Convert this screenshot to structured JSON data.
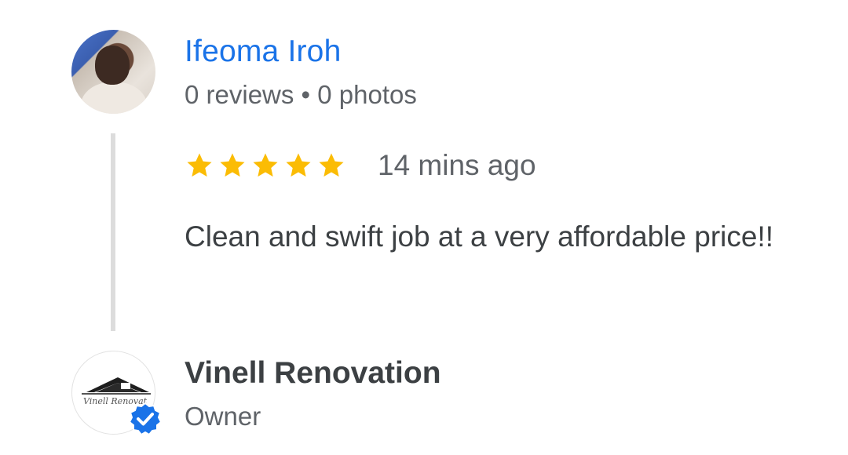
{
  "review": {
    "reviewer": {
      "name": "Ifeoma Iroh",
      "meta": "0 reviews • 0 photos",
      "avatar": "reviewer-photo"
    },
    "rating": {
      "stars": 5,
      "max_stars": 5,
      "star_color": "#fbbc04",
      "icon": "star-icon"
    },
    "timestamp": "14 mins ago",
    "text": "Clean and swift job at a very affordable price!!"
  },
  "owner_response": {
    "name": "Vinell Renovation",
    "role": "Owner",
    "logo_text": "Vinell Renovat",
    "badge_icon": "verified-check-icon",
    "badge_color": "#1a73e8"
  },
  "colors": {
    "link": "#1a73e8",
    "secondary_text": "#5f6368",
    "primary_text": "#3c4043",
    "thread_line": "#dcdcdc"
  }
}
